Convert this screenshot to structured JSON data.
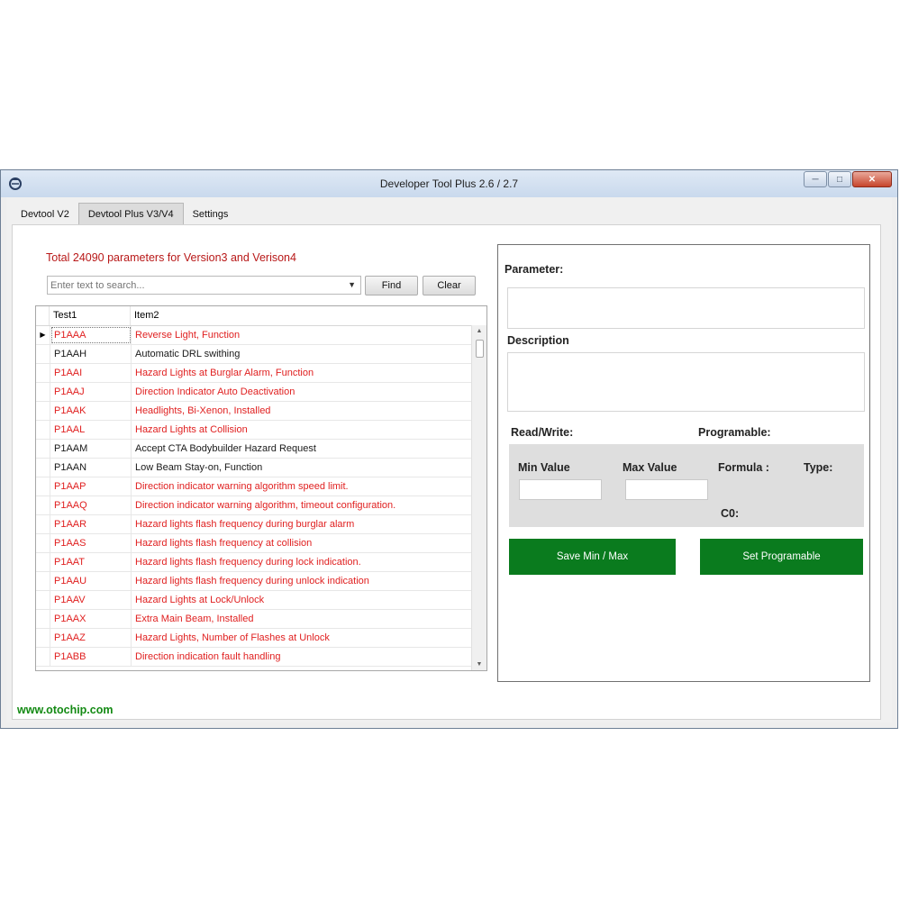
{
  "window": {
    "title": "Developer Tool Plus 2.6 / 2.7"
  },
  "tabs": [
    {
      "label": "Devtool V2"
    },
    {
      "label": "Devtool Plus V3/V4"
    },
    {
      "label": "Settings"
    }
  ],
  "left": {
    "total_label": "Total 24090 parameters for Version3 and Verison4",
    "search_placeholder": "Enter text to search...",
    "find_label": "Find",
    "clear_label": "Clear",
    "columns": [
      "Test1",
      "Item2"
    ],
    "rows": [
      {
        "code": "P1AAA",
        "item": "Reverse Light, Function",
        "red": true
      },
      {
        "code": "P1AAH",
        "item": "Automatic DRL swithing",
        "red": false
      },
      {
        "code": "P1AAI",
        "item": "Hazard Lights at Burglar Alarm, Function",
        "red": true
      },
      {
        "code": "P1AAJ",
        "item": "Direction Indicator Auto Deactivation",
        "red": true
      },
      {
        "code": "P1AAK",
        "item": "Headlights, Bi-Xenon, Installed",
        "red": true
      },
      {
        "code": "P1AAL",
        "item": "Hazard Lights at Collision",
        "red": true
      },
      {
        "code": "P1AAM",
        "item": "Accept CTA Bodybuilder Hazard Request",
        "red": false
      },
      {
        "code": "P1AAN",
        "item": "Low Beam Stay-on, Function",
        "red": false
      },
      {
        "code": "P1AAP",
        "item": "Direction indicator warning algorithm speed limit.",
        "red": true
      },
      {
        "code": "P1AAQ",
        "item": "Direction indicator warning algorithm, timeout configuration.",
        "red": true
      },
      {
        "code": "P1AAR",
        "item": "Hazard lights flash frequency during burglar alarm",
        "red": true
      },
      {
        "code": "P1AAS",
        "item": "Hazard lights flash frequency at collision",
        "red": true
      },
      {
        "code": "P1AAT",
        "item": "Hazard lights flash frequency during lock indication.",
        "red": true
      },
      {
        "code": "P1AAU",
        "item": "Hazard lights flash frequency during unlock indication",
        "red": true
      },
      {
        "code": "P1AAV",
        "item": "Hazard Lights at Lock/Unlock",
        "red": true
      },
      {
        "code": "P1AAX",
        "item": "Extra Main Beam, Installed",
        "red": true
      },
      {
        "code": "P1AAZ",
        "item": "Hazard Lights, Number of Flashes at Unlock",
        "red": true
      },
      {
        "code": "P1ABB",
        "item": "Direction indication fault handling",
        "red": true
      }
    ]
  },
  "right": {
    "parameter_label": "Parameter:",
    "description_label": "Description",
    "readwrite_label": "Read/Write:",
    "programable_label": "Programable:",
    "min_label": "Min Value",
    "max_label": "Max Value",
    "formula_label": "Formula :",
    "type_label": "Type:",
    "c0_label": "C0:",
    "save_label": "Save Min / Max",
    "setprog_label": "Set Programable"
  },
  "footer": {
    "link": "www.otochip.com"
  },
  "colors": {
    "red": "#e02020",
    "green_button": "#0a7b1e",
    "footer_green": "#138a13"
  }
}
